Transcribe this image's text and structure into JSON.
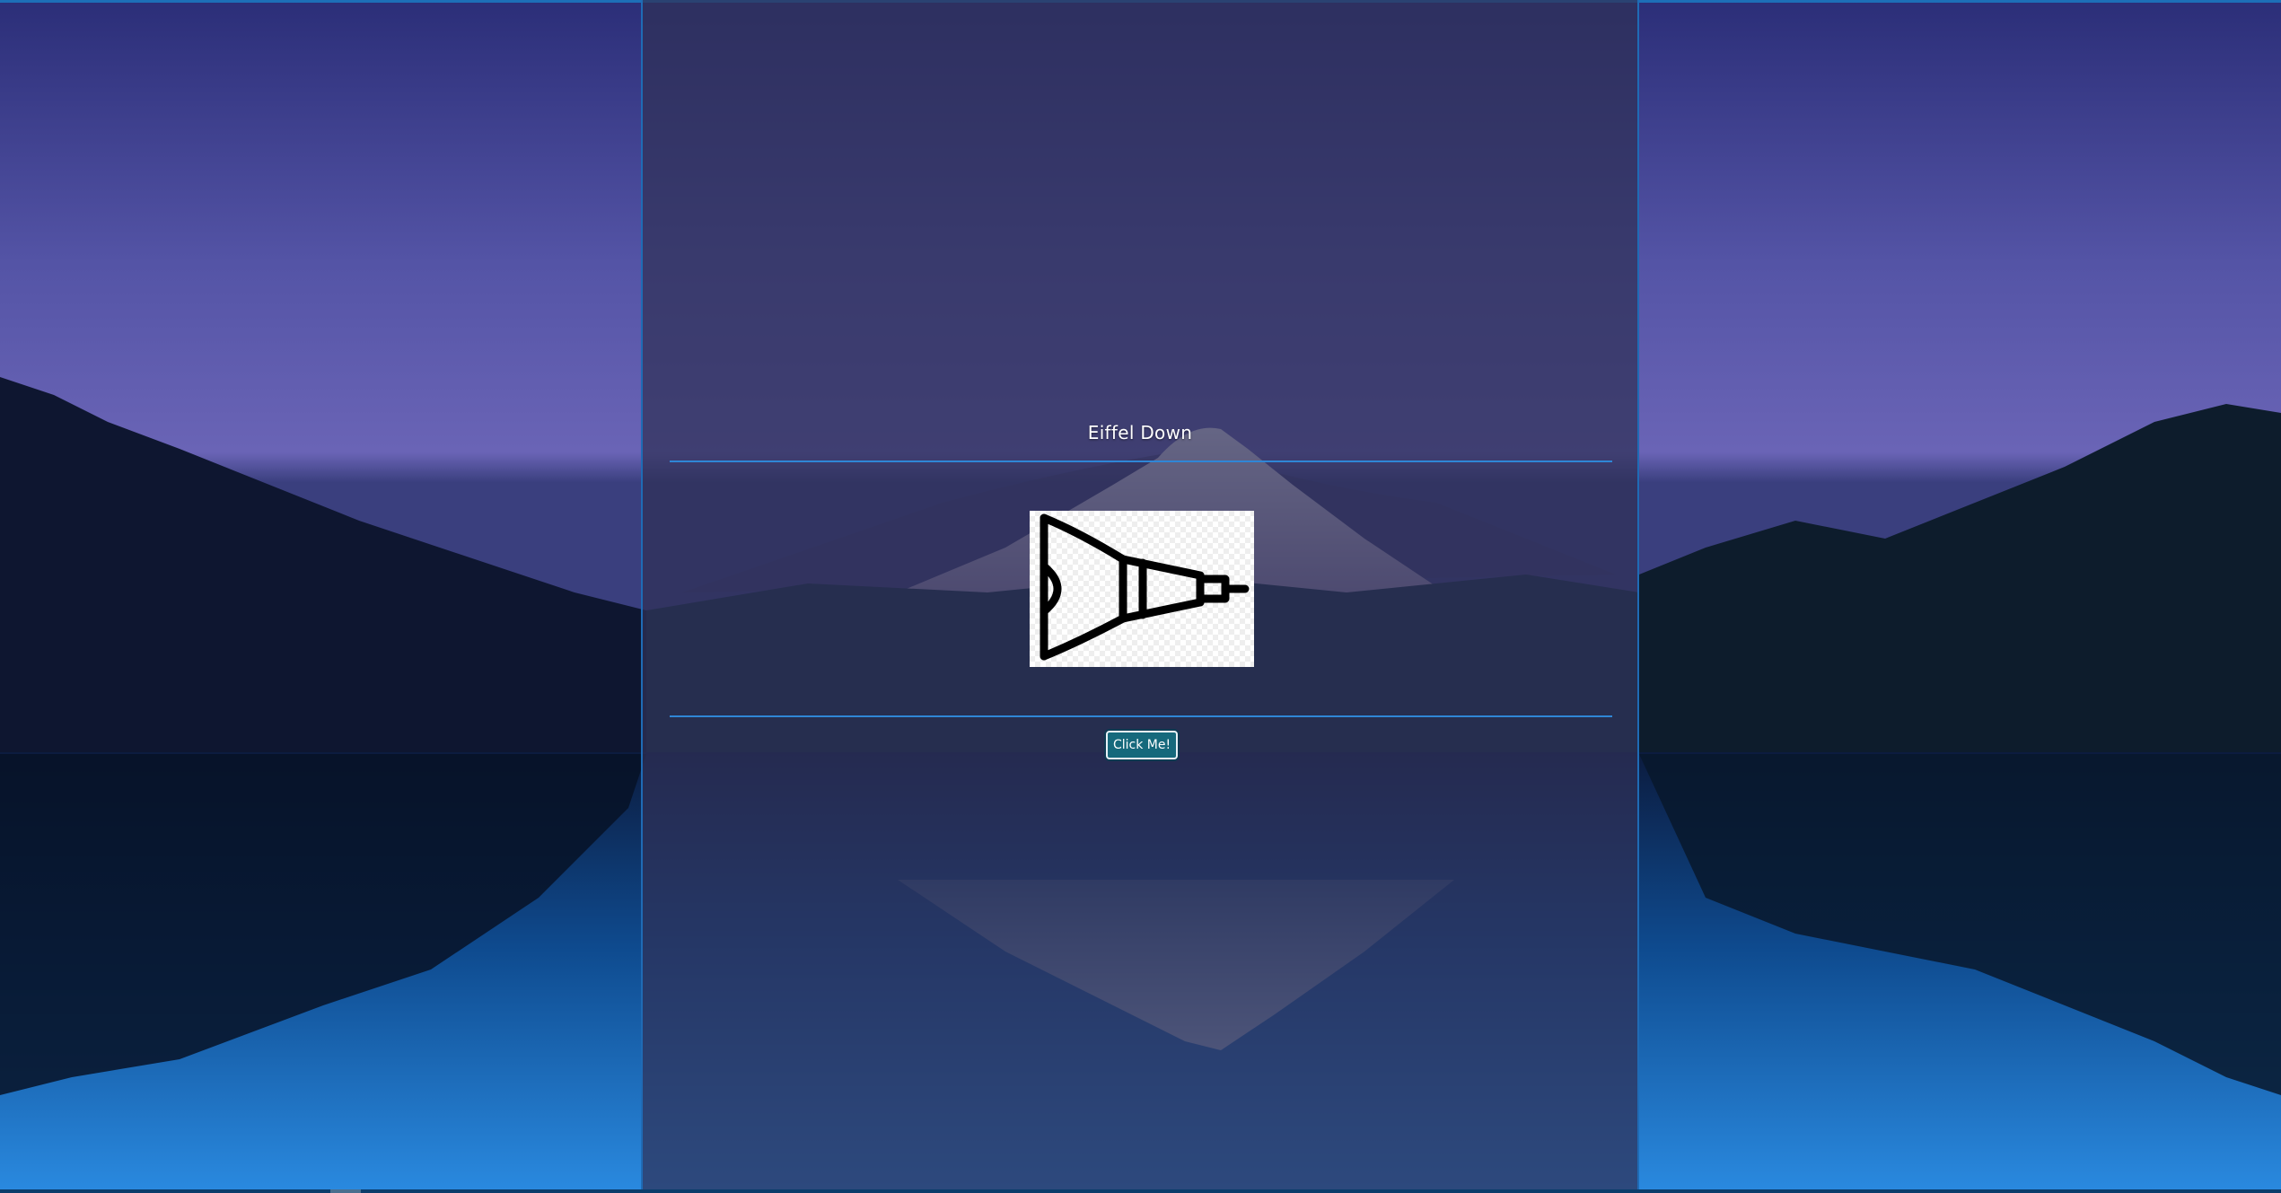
{
  "page": {
    "title": "Eiffel Down",
    "button_label": "Click Me!"
  },
  "image": {
    "icon": "eiffel-tower-icon",
    "orientation": "rotated-90-right"
  },
  "background": {
    "scene": "mountain-lake-at-dusk"
  },
  "colors": {
    "panel_border": "#1f6bb5",
    "divider": "#2f86d6",
    "button_bg": "#16697c",
    "title_text": "#ffffff"
  }
}
